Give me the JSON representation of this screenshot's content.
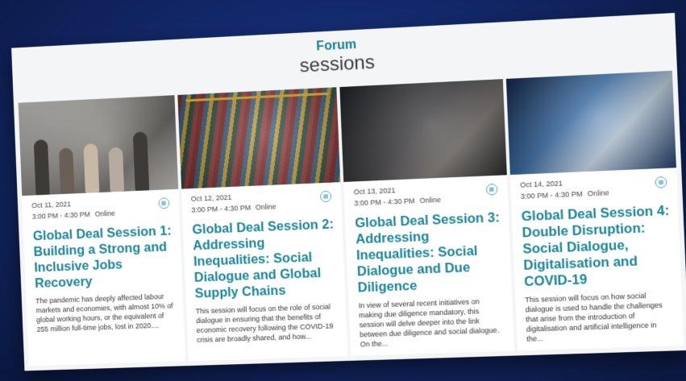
{
  "heading": {
    "kicker": "Forum",
    "title": "sessions"
  },
  "cards": [
    {
      "date": "Oct 11, 2021",
      "time": "3:00 PM - 4:30 PM",
      "mode": "Online",
      "title": "Global Deal Session 1: Building a Strong and Inclusive Jobs Recovery",
      "description": "The pandemic has deeply affected labour markets and economies, with almost 10% of global working hours, or the equivalent of 255 million full-time jobs, lost in 2020....",
      "image_icon": "meeting-photo"
    },
    {
      "date": "Oct 12, 2021",
      "time": "3:00 PM - 4:30 PM",
      "mode": "Online",
      "title": "Global Deal Session 2: Addressing Inequalities: Social Dialogue and Global Supply Chains",
      "description": "This session will focus on the role of social dialogue in ensuring that the benefits of economic recovery following the COVID-19 crisis are broadly shared, and how...",
      "image_icon": "container-port-photo"
    },
    {
      "date": "Oct 13, 2021",
      "time": "3:00 PM - 4:30 PM",
      "mode": "Online",
      "title": "Global Deal Session 3: Addressing Inequalities: Social Dialogue and Due Diligence",
      "description": "In view of several recent initiatives on making due diligence mandatory, this session will delve deeper into the link between due diligence and social dialogue. On the...",
      "image_icon": "audience-photo"
    },
    {
      "date": "Oct 14, 2021",
      "time": "3:00 PM - 4:30 PM",
      "mode": "Online",
      "title": "Global Deal Session 4: Double Disruption: Social Dialogue, Digitalisation and COVID-19",
      "description": "This session will focus on how social dialogue is used to handle the challenges that arise from the introduction of digitalisation and artificial intelligence in the...",
      "image_icon": "robot-photo"
    }
  ],
  "colors": {
    "accent": "#1a8496",
    "background": "#13296d"
  }
}
